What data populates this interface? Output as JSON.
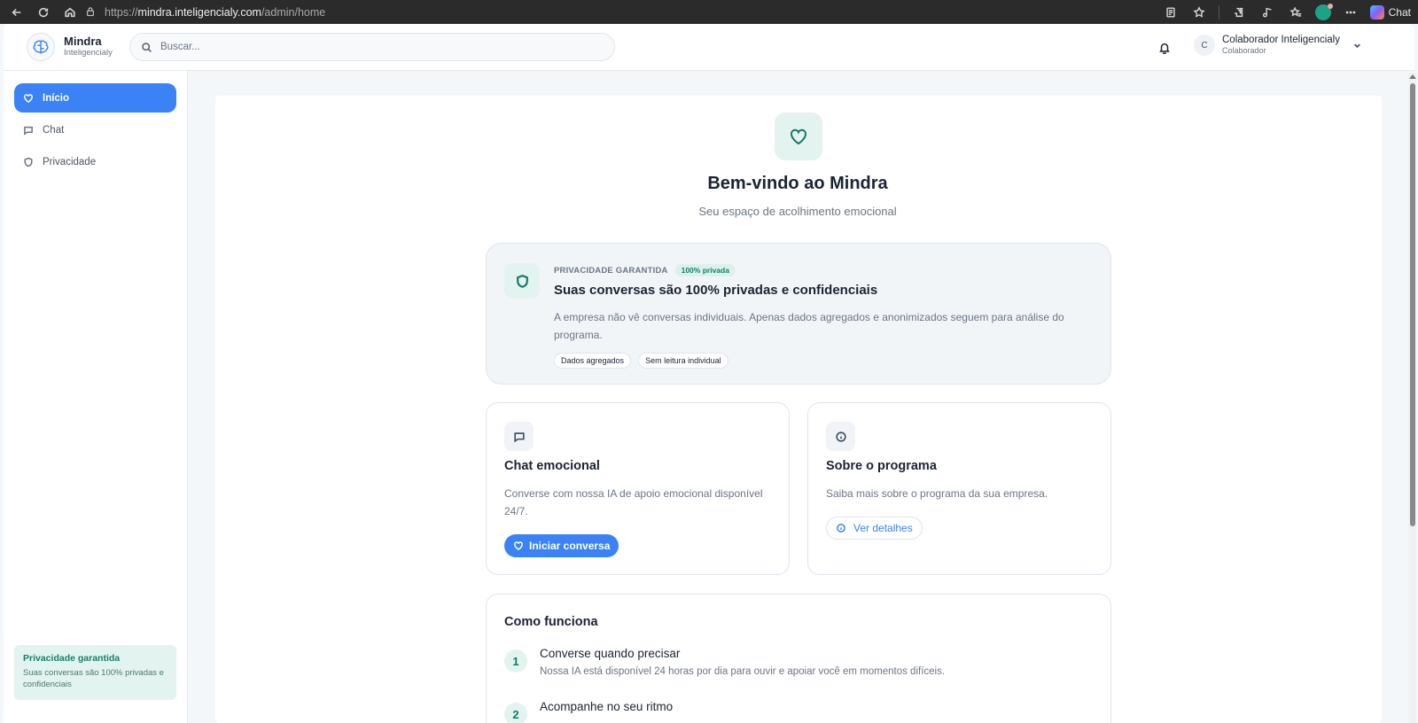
{
  "browser": {
    "url_prefix": "https://",
    "url_domain": "mindra.inteligencialy.com",
    "url_path": "/admin/home",
    "copilot_label": "Chat"
  },
  "header": {
    "brand_name": "Mindra",
    "brand_sub": "Inteligencialy",
    "search_placeholder": "Buscar...",
    "user_initial": "C",
    "user_name": "Colaborador Inteligencialy",
    "user_role": "Colaborador"
  },
  "sidebar": {
    "items": [
      {
        "label": "Início",
        "icon": "heart-icon",
        "active": true
      },
      {
        "label": "Chat",
        "icon": "message-icon",
        "active": false
      },
      {
        "label": "Privacidade",
        "icon": "shield-icon",
        "active": false
      }
    ],
    "privacy_box": {
      "title": "Privacidade garantida",
      "text": "Suas conversas são 100% privadas e confidenciais"
    }
  },
  "hero": {
    "title": "Bem-vindo ao Mindra",
    "subtitle": "Seu espaço de acolhimento emocional"
  },
  "privacy_card": {
    "eyebrow": "PRIVACIDADE GARANTIDA",
    "badge": "100% privada",
    "title": "Suas conversas são 100% privadas e confidenciais",
    "text": "A empresa não vê conversas individuais. Apenas dados agregados e anonimizados seguem para análise do programa.",
    "chips": [
      "Dados agregados",
      "Sem leitura individual"
    ]
  },
  "cards": {
    "chat": {
      "title": "Chat emocional",
      "text": "Converse com nossa IA de apoio emocional disponível 24/7.",
      "button": "Iniciar conversa"
    },
    "about": {
      "title": "Sobre o programa",
      "text": "Saiba mais sobre o programa da sua empresa.",
      "button": "Ver detalhes"
    }
  },
  "how": {
    "title": "Como funciona",
    "steps": [
      {
        "num": "1",
        "title": "Converse quando precisar",
        "text": "Nossa IA está disponível 24 horas por dia para ouvir e apoiar você em momentos difíceis."
      },
      {
        "num": "2",
        "title": "Acompanhe no seu ritmo",
        "text": ""
      }
    ]
  },
  "colors": {
    "primary": "#3b82f6",
    "accent_green": "#107a66",
    "mint_bg": "#e3f3ef"
  }
}
